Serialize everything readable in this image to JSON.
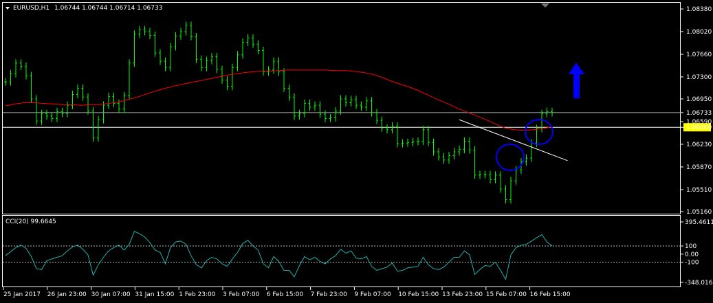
{
  "header": {
    "symbol": "EURUSD,H1",
    "ohlc": "1.06744 1.06744 1.06714 1.06733"
  },
  "indicator": {
    "label": "CCI(20) 99.6645"
  },
  "colors": {
    "background": "#000000",
    "frame": "#ffffff",
    "candles": "#00ff00",
    "moving_average": "#ff0000",
    "cci": "#20b2aa",
    "trendline": "#ffffff",
    "circles": "#0000ff",
    "arrow": "#0000ff",
    "current_price_tag": "#ffff00"
  },
  "icons": {
    "menu": "triangle-down-icon",
    "annotation_arrow": "arrow-up-icon"
  },
  "chart_data": [
    {
      "type": "line",
      "title": "EURUSD,H1",
      "ylim": [
        1.0516,
        1.0838
      ],
      "price_ticks": [
        "1.08380",
        "1.08020",
        "1.07660",
        "1.07300",
        "1.06950",
        "1.06733",
        "1.06590",
        "1.06500",
        "1.06230",
        "1.05870",
        "1.05510",
        "1.05160"
      ],
      "current_price": 1.06733,
      "horizontal_level": 1.065,
      "x_labels": [
        "25 Jan 2017",
        "26 Jan 23:00",
        "30 Jan 07:00",
        "31 Jan 15:00",
        "1 Feb 23:00",
        "3 Feb 07:00",
        "6 Feb 15:00",
        "7 Feb 23:00",
        "9 Feb 07:00",
        "10 Feb 15:00",
        "13 Feb 23:00",
        "15 Feb 07:00",
        "16 Feb 15:00"
      ],
      "series": [
        {
          "values": [
            1.0722,
            1.0735,
            1.0752,
            1.0747,
            1.0732,
            1.0695,
            1.066,
            1.0672,
            1.0668,
            1.0664,
            1.0675,
            1.0672,
            1.0685,
            1.0702,
            1.0712,
            1.0698,
            1.0676,
            1.0633,
            1.0662,
            1.0685,
            1.0699,
            1.0688,
            1.0679,
            1.07,
            1.0752,
            1.0798,
            1.0805,
            1.0802,
            1.0796,
            1.0768,
            1.0755,
            1.0745,
            1.0778,
            1.0795,
            1.0802,
            1.0812,
            1.0794,
            1.0758,
            1.0745,
            1.0756,
            1.0762,
            1.0742,
            1.0725,
            1.0715,
            1.0745,
            1.0765,
            1.0785,
            1.0792,
            1.0782,
            1.0772,
            1.0738,
            1.0741,
            1.0755,
            1.0738,
            1.0712,
            1.0698,
            1.0668,
            1.0672,
            1.0688,
            1.0682,
            1.0685,
            1.0671,
            1.0664,
            1.0665,
            1.0676,
            1.0695,
            1.0689,
            1.0694,
            1.0685,
            1.0682,
            1.0692,
            1.0673,
            1.0661,
            1.0649,
            1.0646,
            1.0652,
            1.0624,
            1.0625,
            1.0626,
            1.0627,
            1.0628,
            1.0646,
            1.0626,
            1.0611,
            1.0603,
            1.0598,
            1.0605,
            1.0611,
            1.0615,
            1.0628,
            1.0614,
            1.0574,
            1.0575,
            1.0575,
            1.0567,
            1.0574,
            1.0552,
            1.0535,
            1.0565,
            1.0582,
            1.0595,
            1.0601,
            1.0625,
            1.0648,
            1.0672,
            1.0675,
            1.0673
          ],
          "color": "#00ff00"
        },
        {
          "values": [
            1.0684,
            1.0687,
            1.0689,
            1.0689,
            1.0688,
            1.0687,
            1.0686,
            1.0686,
            1.0685,
            1.0686,
            1.0686,
            1.0688,
            1.069,
            1.0694,
            1.0698,
            1.0703,
            1.0708,
            1.0712,
            1.0716,
            1.0719,
            1.0722,
            1.0725,
            1.0728,
            1.0731,
            1.0734,
            1.0736,
            1.0738,
            1.0739,
            1.0739,
            1.074,
            1.0741,
            1.0741,
            1.0741,
            1.0741,
            1.0741,
            1.074,
            1.074,
            1.0739,
            1.0737,
            1.0734,
            1.0729,
            1.0723,
            1.0718,
            1.0713,
            1.0707,
            1.07,
            1.0693,
            1.0687,
            1.068,
            1.0674,
            1.0668,
            1.0662,
            1.0655,
            1.0649,
            1.0646,
            1.0645,
            1.0646,
            1.0648,
            1.0651
          ],
          "color": "#ff0000"
        }
      ],
      "trendline": {
        "x_index": [
          88,
          109
        ],
        "y": [
          1.0662,
          1.0597
        ]
      },
      "annotations": [
        "blue-circle",
        "blue-circle",
        "up-arrow"
      ]
    },
    {
      "type": "line",
      "title": "CCI(20) 99.6645",
      "ylim": [
        -348.0164,
        395.4611
      ],
      "ticks": [
        "395.4611",
        "100",
        "0.00",
        "-100",
        "-348.0164"
      ],
      "levels": [
        100,
        -100
      ],
      "series": [
        {
          "values": [
            -20,
            30,
            80,
            110,
            70,
            -30,
            -180,
            -190,
            -80,
            -60,
            -40,
            -20,
            40,
            90,
            110,
            60,
            -10,
            -260,
            -130,
            -40,
            40,
            80,
            110,
            50,
            120,
            280,
            250,
            210,
            140,
            50,
            20,
            -120,
            80,
            150,
            160,
            120,
            -20,
            -130,
            -170,
            -80,
            -40,
            -60,
            -120,
            -150,
            -60,
            20,
            130,
            170,
            100,
            50,
            -120,
            -170,
            -30,
            -90,
            -200,
            -200,
            -280,
            -140,
            -30,
            -70,
            -40,
            -90,
            -120,
            -60,
            -20,
            60,
            10,
            40,
            -50,
            -60,
            -30,
            -150,
            -200,
            -180,
            -160,
            -110,
            -210,
            -200,
            -170,
            -160,
            -150,
            -40,
            -130,
            -180,
            -190,
            -160,
            -100,
            -40,
            -40,
            40,
            -10,
            -250,
            -190,
            -140,
            -150,
            -100,
            -200,
            -310,
            -10,
            80,
            110,
            120,
            160,
            200,
            240,
            150,
            100
          ],
          "color": "#20b2aa"
        }
      ]
    }
  ]
}
